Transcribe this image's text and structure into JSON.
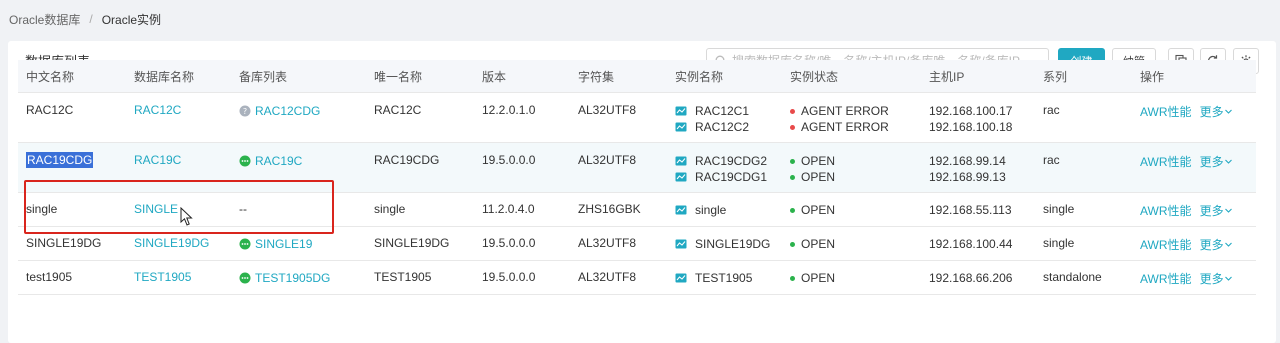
{
  "breadcrumb": {
    "items": [
      "Oracle数据库",
      "Oracle实例"
    ],
    "separator": "/"
  },
  "card": {
    "title": "数据库列表",
    "search_placeholder": "搜索数据库名称/唯一名称/主机IP/备库唯一名称/备库IP",
    "create_label": "创建",
    "manage_label": "纳管"
  },
  "table": {
    "headers": [
      "中文名称",
      "数据库名称",
      "备库列表",
      "唯一名称",
      "版本",
      "字符集",
      "实例名称",
      "实例状态",
      "主机IP",
      "系列",
      "操作"
    ],
    "rows": [
      {
        "cn_name": "RAC12C",
        "db_name": "RAC12C",
        "standby": "RAC12CDG",
        "standby_status": "unknown",
        "unique_name": "RAC12C",
        "version": "12.2.0.1.0",
        "charset": "AL32UTF8",
        "instances": [
          "RAC12C1",
          "RAC12C2"
        ],
        "states": [
          "AGENT ERROR",
          "AGENT ERROR"
        ],
        "hosts": [
          "192.168.100.17",
          "192.168.100.18"
        ],
        "series": "rac",
        "op_awr": "AWR性能",
        "op_more": "更多"
      },
      {
        "cn_name": "RAC19CDG",
        "db_name": "RAC19C",
        "standby": "RAC19C",
        "standby_status": "ok",
        "unique_name": "RAC19CDG",
        "version": "19.5.0.0.0",
        "charset": "AL32UTF8",
        "instances": [
          "RAC19CDG2",
          "RAC19CDG1"
        ],
        "states": [
          "OPEN",
          "OPEN"
        ],
        "hosts": [
          "192.168.99.14",
          "192.168.99.13"
        ],
        "series": "rac",
        "op_awr": "AWR性能",
        "op_more": "更多"
      },
      {
        "cn_name": "single",
        "db_name": "SINGLE",
        "standby": "--",
        "standby_status": "none",
        "unique_name": "single",
        "version": "11.2.0.4.0",
        "charset": "ZHS16GBK",
        "instances": [
          "single"
        ],
        "states": [
          "OPEN"
        ],
        "hosts": [
          "192.168.55.113"
        ],
        "series": "single",
        "op_awr": "AWR性能",
        "op_more": "更多"
      },
      {
        "cn_name": "SINGLE19DG",
        "db_name": "SINGLE19DG",
        "standby": "SINGLE19",
        "standby_status": "ok",
        "unique_name": "SINGLE19DG",
        "version": "19.5.0.0.0",
        "charset": "AL32UTF8",
        "instances": [
          "SINGLE19DG"
        ],
        "states": [
          "OPEN"
        ],
        "hosts": [
          "192.168.100.44"
        ],
        "series": "single",
        "op_awr": "AWR性能",
        "op_more": "更多"
      },
      {
        "cn_name": "test1905",
        "db_name": "TEST1905",
        "standby": "TEST1905DG",
        "standby_status": "ok",
        "unique_name": "TEST1905",
        "version": "19.5.0.0.0",
        "charset": "AL32UTF8",
        "instances": [
          "TEST1905"
        ],
        "states": [
          "OPEN"
        ],
        "hosts": [
          "192.168.66.206"
        ],
        "series": "standalone",
        "op_awr": "AWR性能",
        "op_more": "更多"
      }
    ]
  },
  "colors": {
    "accent": "#20a8c2",
    "ok": "#2bb24c",
    "error": "#e84a4a",
    "selection": "#3a70d8",
    "highlight_box": "#d9251d"
  }
}
